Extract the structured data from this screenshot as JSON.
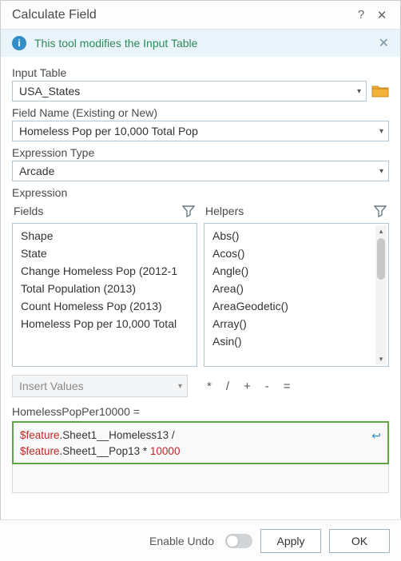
{
  "titlebar": {
    "title": "Calculate Field"
  },
  "infobar": {
    "text": "This tool modifies the Input Table"
  },
  "inputTable": {
    "label": "Input Table",
    "value": "USA_States"
  },
  "fieldName": {
    "label": "Field Name (Existing or New)",
    "value": "Homeless Pop per 10,000 Total Pop"
  },
  "exprType": {
    "label": "Expression Type",
    "value": "Arcade"
  },
  "expression": {
    "label": "Expression",
    "fieldsHeader": "Fields",
    "helpersHeader": "Helpers",
    "fields": [
      "Shape",
      "State",
      "Change Homeless Pop (2012-1",
      "Total Population (2013)",
      "Count Homeless Pop (2013)",
      "Homeless Pop per 10,000 Total"
    ],
    "helpers": [
      "Abs()",
      "Acos()",
      "Angle()",
      "Area()",
      "AreaGeodetic()",
      "Array()",
      "Asin()"
    ],
    "insertValues": "Insert Values",
    "ops": [
      "*",
      "/",
      "+",
      "-",
      "="
    ],
    "resultLabel": "HomelessPopPer10000 =",
    "code": {
      "line1_feat": "$feature",
      "line1_rest": ".Sheet1__Homeless13 /",
      "line2_feat": "$feature",
      "line2_mid": ".Sheet1__Pop13 * ",
      "line2_num": "10000"
    }
  },
  "footer": {
    "undoLabel": "Enable Undo",
    "apply": "Apply",
    "ok": "OK"
  }
}
